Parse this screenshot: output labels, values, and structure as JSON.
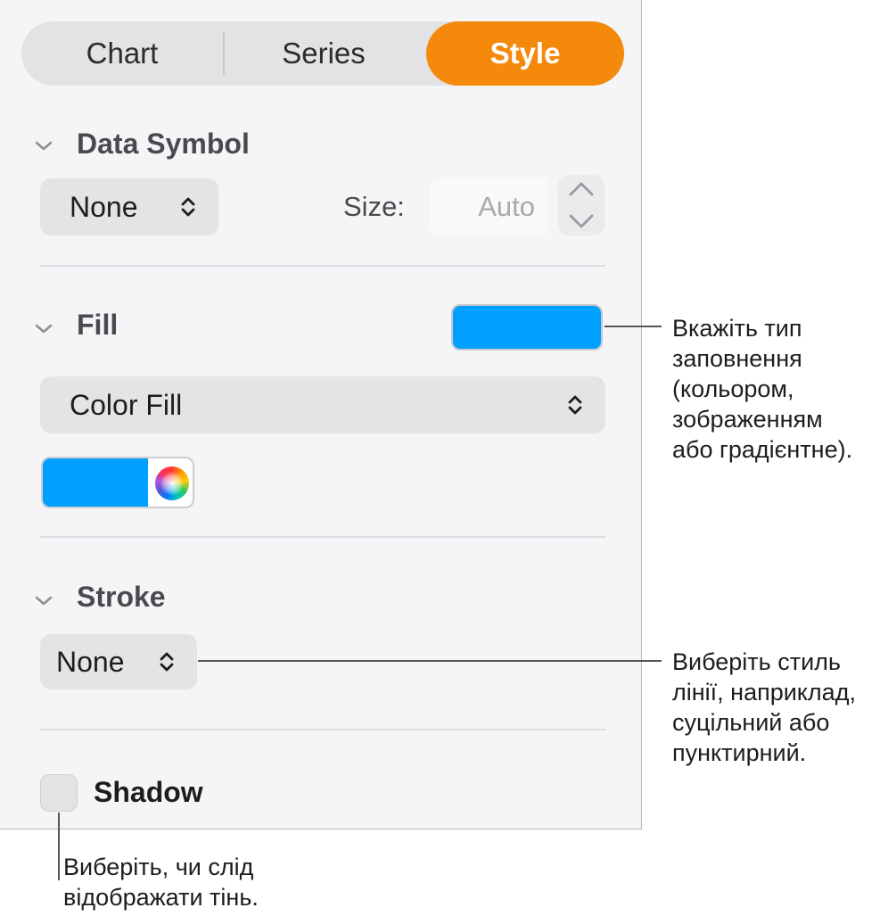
{
  "tabs": [
    {
      "label": "Chart",
      "active": false
    },
    {
      "label": "Series",
      "active": false
    },
    {
      "label": "Style",
      "active": true
    }
  ],
  "data_symbol": {
    "title": "Data Symbol",
    "shape_value": "None",
    "size_label": "Size:",
    "size_placeholder": "Auto"
  },
  "fill": {
    "title": "Fill",
    "fill_type": "Color Fill",
    "color": "#00a0ff"
  },
  "stroke": {
    "title": "Stroke",
    "style_value": "None"
  },
  "shadow": {
    "label": "Shadow",
    "checked": false
  },
  "callouts": {
    "fill": [
      "Вкажіть тип",
      "заповнення",
      "(кольором,",
      "зображенням",
      "або градієнтне)."
    ],
    "stroke": [
      "Виберіть стиль",
      "лінії, наприклад,",
      "суцільний або",
      "пунктирний."
    ],
    "shadow": [
      "Виберіть, чи слід",
      "відображати тінь."
    ]
  },
  "colors": {
    "accent": "#f5890b",
    "fill_color": "#00a0ff"
  }
}
